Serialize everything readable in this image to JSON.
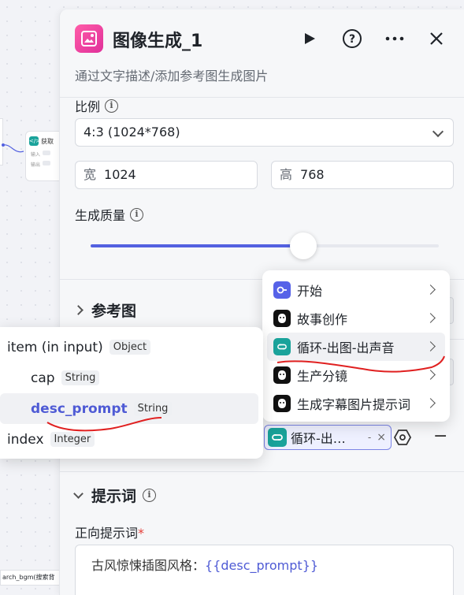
{
  "background": {
    "node_label": "获取",
    "node_input_label": "输入",
    "node_output_label": "输出",
    "bottom_label": "arch_bgm(搜索背"
  },
  "panel": {
    "title": "图像生成_1",
    "description": "通过文字描述/添加参考图生成图片",
    "ratio_label": "比例",
    "ratio_value": "4:3 (1024*768)",
    "width_prefix": "宽",
    "width_value": "1024",
    "height_prefix": "高",
    "height_value": "768",
    "quality_label": "生成质量",
    "quality_level": 0.61,
    "reference_section": "参考图",
    "prompt_section": "提示词",
    "positive_prompt_label": "正向提示词",
    "required_mark": "*",
    "prompt_text": "古风惊悚插图风格：",
    "prompt_var": "{{desc_prompt}}",
    "var_chip_label": "循环-出…",
    "var_chip_dash": "-",
    "var_chip_close": "×",
    "minus": "−"
  },
  "node_menu": {
    "items": [
      {
        "label": "开始",
        "icon": "start-icon"
      },
      {
        "label": "故事创作",
        "icon": "robot-icon"
      },
      {
        "label": "循环-出图-出声音",
        "icon": "loop-icon"
      },
      {
        "label": "生产分镜",
        "icon": "robot-icon"
      },
      {
        "label": "生成字幕图片提示词",
        "icon": "robot-icon"
      }
    ],
    "active_index": 2
  },
  "var_menu": {
    "items": [
      {
        "name": "item (in input)",
        "type": "Object"
      },
      {
        "name": "cap",
        "type": "String"
      },
      {
        "name": "desc_prompt",
        "type": "String"
      },
      {
        "name": "index",
        "type": "Integer"
      }
    ],
    "selected_index": 2
  },
  "colors": {
    "accent": "#5361e0",
    "node_icon": "#e0309a",
    "loop_icon": "#1aa39b",
    "annotation": "#e02020"
  }
}
